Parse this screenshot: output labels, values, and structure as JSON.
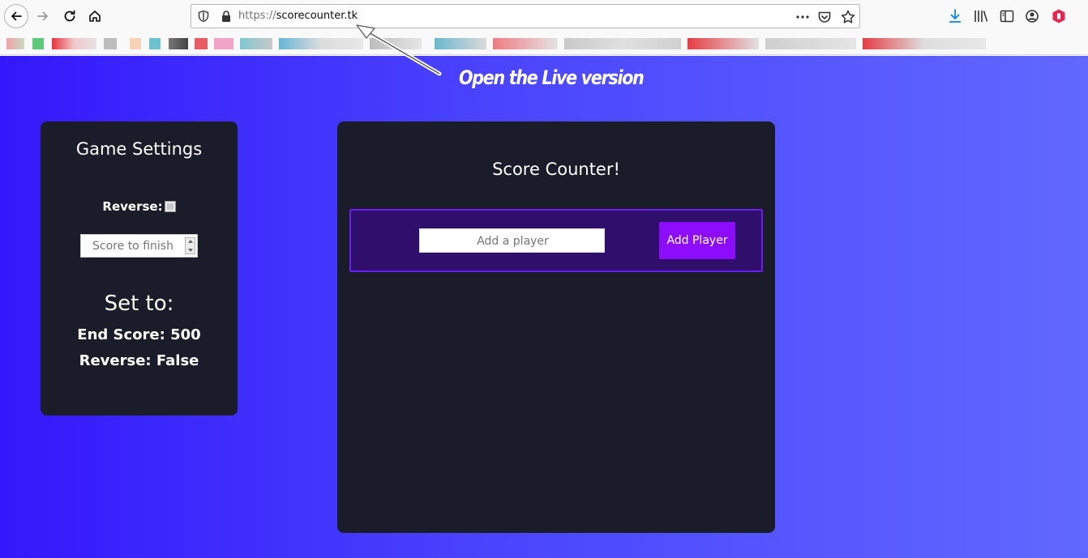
{
  "browser": {
    "url_scheme": "https://",
    "url_host": "scorecounter.tk"
  },
  "annotation": {
    "text": "Open the Live version"
  },
  "settings": {
    "title": "Game Settings",
    "reverse_label": "Reverse:",
    "reverse_checked": false,
    "score_placeholder": "Score to finish",
    "set_to_heading": "Set to:",
    "end_score_text": "End Score: 500",
    "reverse_text": "Reverse: False"
  },
  "main": {
    "title": "Score Counter!",
    "player_placeholder": "Add a player",
    "add_button_label": "Add Player"
  },
  "colors": {
    "panel_bg": "#1b1c2a",
    "add_box_bg": "#300f6c",
    "add_box_border": "#6b1cf0",
    "button_bg": "#8d0cfc",
    "gradient_start": "#3418fb",
    "gradient_end": "#6168ff"
  },
  "icons": {
    "toolbar": [
      "back-icon",
      "forward-icon",
      "reload-icon",
      "home-icon",
      "tracking-shield-icon",
      "lock-icon",
      "page-actions-icon",
      "pocket-icon",
      "bookmark-star-icon",
      "download-icon",
      "library-icon",
      "sidebar-icon",
      "account-icon",
      "addon-icon"
    ]
  }
}
